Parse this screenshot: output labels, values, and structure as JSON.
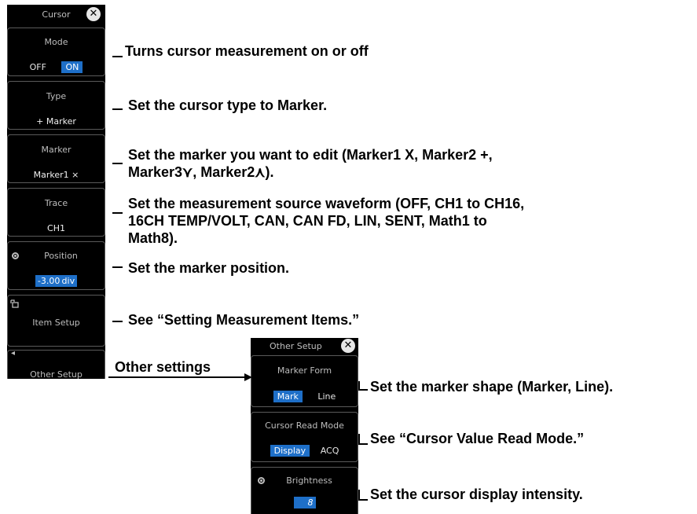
{
  "cursor_panel": {
    "title": "Cursor",
    "close_symbol": "✕",
    "mode": {
      "title": "Mode",
      "off": "OFF",
      "on": "ON"
    },
    "type": {
      "title": "Type",
      "value": "+ Marker"
    },
    "marker": {
      "title": "Marker",
      "value": "Marker1 ×"
    },
    "trace": {
      "title": "Trace",
      "value": "CH1"
    },
    "position": {
      "title": "Position",
      "value": "-3.00 div"
    },
    "item_setup": {
      "label": "Item Setup",
      "icon": "item-setup-icon"
    },
    "other_setup": {
      "label": "Other Setup",
      "icon": "left-arrow-icon",
      "arrow": "◂"
    }
  },
  "other_panel": {
    "title": "Other Setup",
    "close_symbol": "✕",
    "marker_form": {
      "title": "Marker Form",
      "mark": "Mark",
      "line": "Line"
    },
    "read_mode": {
      "title": "Cursor Read Mode",
      "display": "Display",
      "acq": "ACQ"
    },
    "brightness": {
      "title": "Brightness",
      "value": "8"
    }
  },
  "annotations": {
    "mode": "Turns cursor measurement on or off",
    "type": "Set the cursor type to Marker.",
    "marker_l1": "Set the marker you want to edit (Marker1 X, Marker2 +,",
    "marker_l2": "Marker3⋎, Marker2⋏).",
    "trace_l1": "Set the measurement source waveform (OFF, CH1 to CH16,",
    "trace_l2": "16CH TEMP/VOLT, CAN, CAN FD, LIN, SENT, Math1 to",
    "trace_l3": "Math8).",
    "position": "Set the marker position.",
    "item_setup": "See “Setting Measurement Items.”",
    "other_settings": "Other settings",
    "marker_form": "Set the marker shape (Marker, Line).",
    "read_mode": "See “Cursor Value Read Mode.”",
    "brightness": "Set the cursor display intensity."
  },
  "colors": {
    "panel_bg": "#000000",
    "selected": "#1e6fc8",
    "border": "#5a5a5a"
  }
}
